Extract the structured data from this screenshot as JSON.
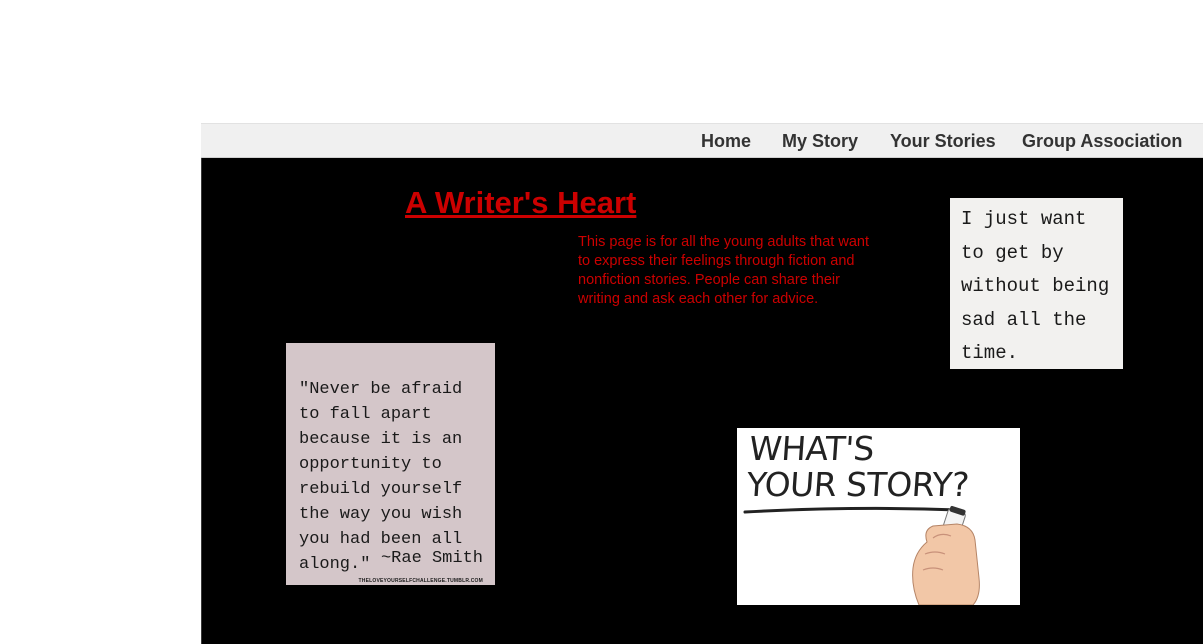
{
  "nav": {
    "items": [
      {
        "label": "Home"
      },
      {
        "label": "My Story"
      },
      {
        "label": "Your Stories"
      },
      {
        "label": "Group Association"
      }
    ]
  },
  "main": {
    "title": "A Writer's Heart",
    "intro": "This page is for all the young adults that want to express their feelings through fiction and nonfiction stories. People can share their writing and ask each other for advice."
  },
  "images": {
    "quote_right": "I just want\nto get by\nwithout being\nsad all the\ntime.",
    "quote_left": "\"Never be afraid\nto fall apart\nbecause it is an\nopportunity to\nrebuild yourself\nthe way you wish\nyou had been all\nalong.\"",
    "quote_left_author": "~Rae Smith",
    "quote_left_source": "THELOVEYOURSELFCHALLENGE.TUMBLR.COM",
    "story_line1": "WHAT'S",
    "story_line2": "YOUR STORY?"
  },
  "colors": {
    "accent": "#cc0000",
    "background": "#000000",
    "navbar": "#f0f0f0"
  }
}
